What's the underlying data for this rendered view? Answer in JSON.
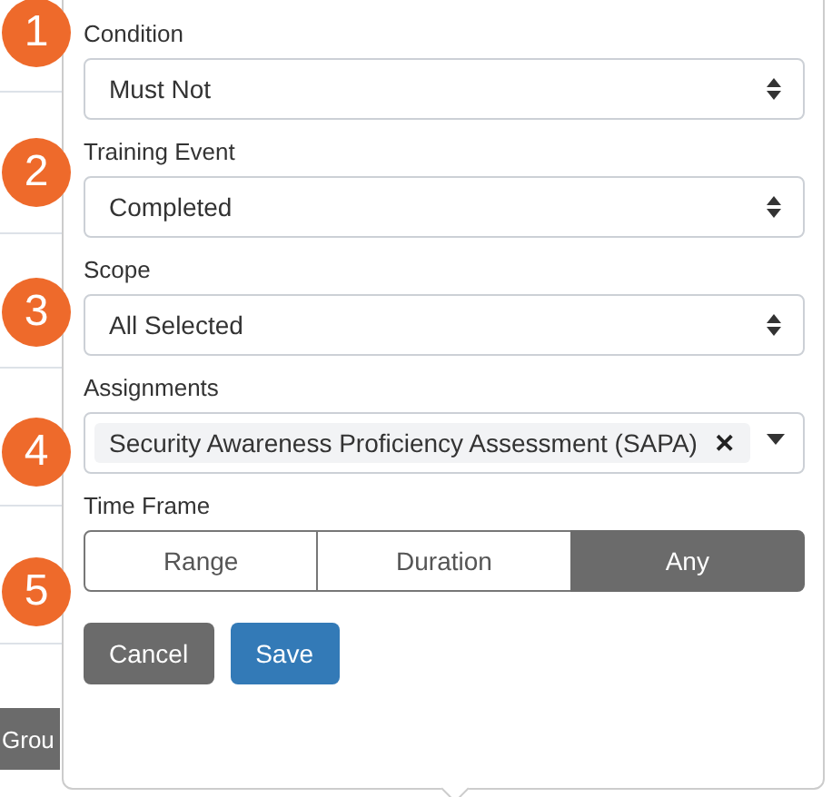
{
  "background": {
    "button_fragment": "Grou"
  },
  "fields": [
    {
      "kind": "select",
      "step": "1",
      "label": "Condition",
      "value": "Must Not"
    },
    {
      "kind": "select",
      "step": "2",
      "label": "Training Event",
      "value": "Completed"
    },
    {
      "kind": "select",
      "step": "3",
      "label": "Scope",
      "value": "All Selected"
    },
    {
      "kind": "multiselect",
      "step": "4",
      "label": "Assignments",
      "tags": [
        "Security Awareness Proficiency Assessment (SAPA)"
      ],
      "remove_glyph": "✕"
    },
    {
      "kind": "segmented",
      "step": "5",
      "label": "Time Frame",
      "options": [
        {
          "label": "Range",
          "selected": false
        },
        {
          "label": "Duration",
          "selected": false
        },
        {
          "label": "Any",
          "selected": true
        }
      ]
    }
  ],
  "buttons": [
    {
      "label": "Cancel",
      "kind": "secondary"
    },
    {
      "label": "Save",
      "kind": "primary"
    }
  ]
}
